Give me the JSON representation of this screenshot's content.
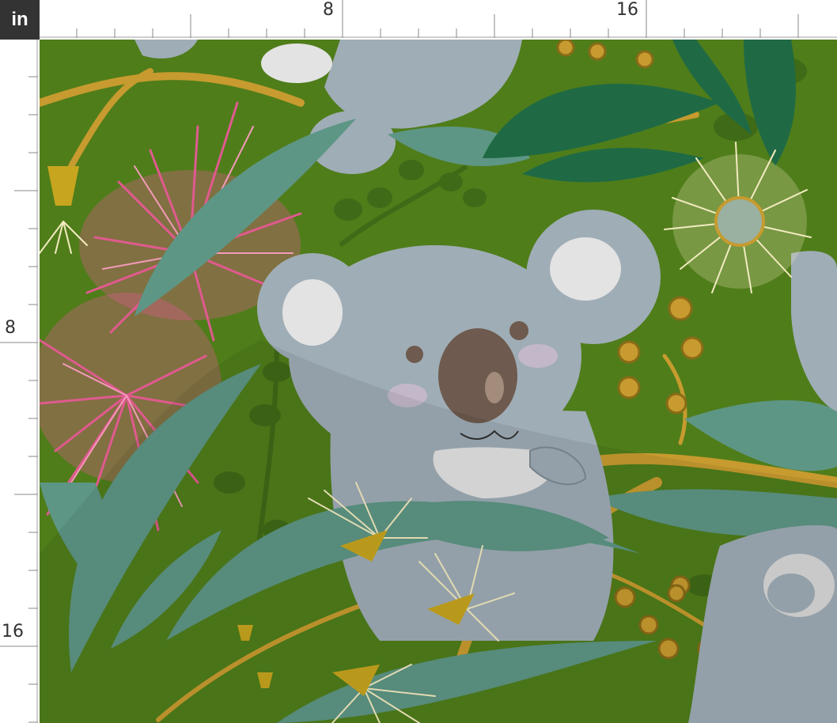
{
  "ruler": {
    "unit_label": "in",
    "top_labels": [
      "8",
      "16"
    ],
    "left_labels": [
      "8",
      "16"
    ]
  },
  "pattern": {
    "background_color": "#4f7d1a",
    "koala_color": "#9fadb6",
    "leaf_teal": "#5e9685",
    "leaf_dark": "#1f6a45",
    "branch_color": "#c79b2f",
    "bottlebrush_pink": "#e05a8f",
    "blossom_cream": "#f3ebc0"
  }
}
